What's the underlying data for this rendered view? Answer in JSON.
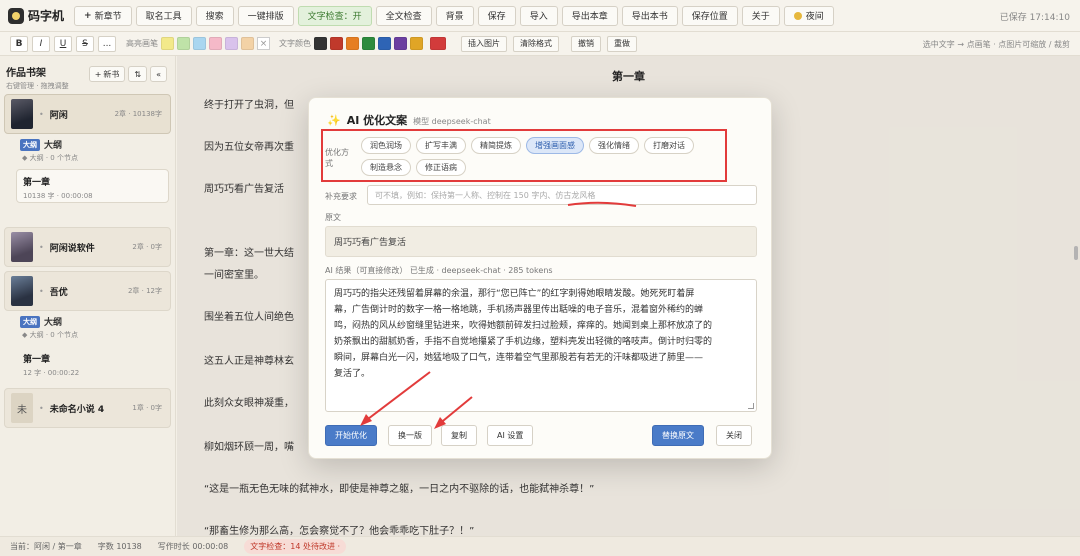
{
  "app": {
    "name": "码字机",
    "saved": "已保存 17:14:10"
  },
  "toolbar": [
    {
      "label": "新章节",
      "plus": true
    },
    {
      "label": "取名工具"
    },
    {
      "label": "搜索"
    },
    {
      "label": "一键排版"
    },
    {
      "label": "文字检查：开",
      "active": true
    },
    {
      "label": "全文检查"
    },
    {
      "label": "背景"
    },
    {
      "label": "保存"
    },
    {
      "label": "导入"
    },
    {
      "label": "导出本章"
    },
    {
      "label": "导出本书"
    },
    {
      "label": "保存位置"
    },
    {
      "label": "关于"
    },
    {
      "label": "夜间",
      "icon": "moon-icon"
    }
  ],
  "format": {
    "bold": "B",
    "italic": "I",
    "underline": "U",
    "strike": "S",
    "more": "...",
    "highlight_label": "高亮画笔",
    "highlight_colors": [
      "#f3e98a",
      "#bfe3a8",
      "#a9d6f0",
      "#f5b9c8",
      "#d9c2ec",
      "#f3d2a6"
    ],
    "clear_mark": "×",
    "text_color_label": "文字颜色",
    "text_colors": [
      "#333333",
      "#c0392b",
      "#e67e22",
      "#2e8b3d",
      "#2e64b5",
      "#6b3fa0",
      "#e0a526"
    ],
    "text_color_current": "#d23b3b",
    "insert_image": "插入图片",
    "clear_format": "清除格式",
    "undo": "撤销",
    "redo": "重做",
    "hint": "选中文字 → 点画笔 · 点图片可缩放 / 裁剪"
  },
  "sidebar": {
    "title": "作品书架",
    "subtitle": "右键管理 · 拖拽调整",
    "new_book": "新书",
    "sort": "⇅",
    "collapse": "«",
    "books": [
      {
        "name": "阿闲",
        "meta": "2章 · 10138字",
        "active": true
      },
      {
        "name": "阿闲说软件",
        "meta": "2章 · 0字"
      },
      {
        "name": "吾优",
        "meta": "2章 · 12字"
      },
      {
        "name": "未命名小说 4",
        "meta": "1章 · 0字",
        "cover_char": "未"
      }
    ],
    "outline_tag": "大纲",
    "outline1": {
      "title": "大纲",
      "sub": "◆ 大纲 · 0 个节点"
    },
    "chapter1": {
      "title": "第一章",
      "meta": "10138 字 · 00:00:08"
    },
    "outline2": {
      "title": "大纲",
      "sub": "◆ 大纲 · 0 个节点"
    },
    "chapter2": {
      "title": "第一章",
      "meta": "12 字 · 00:00:22"
    }
  },
  "editor": {
    "chapter_title": "第一章",
    "paragraphs": [
      "终于打开了虫洞，但",
      "因为五位女帝再次重",
      "周巧巧看广告复活",
      "第一章：这一世大结",
      "一间密室里。",
      "围坐着五位人间绝色",
      "这五人正是神尊林玄",
      "此刻众女眼神凝重，",
      "柳如烟环顾一周，嘴",
      "“这是一瓶无色无味的弑神水，即使是神尊之躯，一日之内不驱除的话，也能弑神杀尊！”",
      "“那畜生修为那么高，怎会察觉不了？他会乖乖吃下肚子？！”"
    ]
  },
  "status": {
    "location": "当前：阿闲 / 第一章",
    "words": "字数 10138",
    "time": "写作时长 00:00:08",
    "check": "文字检查：14 处待改进 ·"
  },
  "dialog": {
    "title": "AI 优化文案",
    "model": "模型 deepseek-chat",
    "opt_label": "优化方式",
    "options": [
      {
        "label": "润色润场"
      },
      {
        "label": "扩写丰满"
      },
      {
        "label": "精简提炼"
      },
      {
        "label": "增强画面感",
        "selected": true
      },
      {
        "label": "强化情绪"
      },
      {
        "label": "打磨对话"
      },
      {
        "label": "制造悬念"
      },
      {
        "label": "修正语病"
      }
    ],
    "supp_label": "补充要求",
    "supp_placeholder": "可不填，例如：保持第一人称、控制在 150 字内、仿古龙风格",
    "orig_label": "原文",
    "orig_text": "周巧巧看广告复活",
    "result_label": "AI 结果（可直接修改）   已生成 · deepseek-chat · 285 tokens",
    "result_lines": [
      "周巧巧的指尖还残留着屏幕的余温，那行“您已阵亡”的红字刺得她眼睛发酸。她死死盯着屏",
      "幕，广告倒计时的数字一格一格地跳，手机扬声器里传出聒噪的电子音乐，混着窗外稀约的蝉",
      "鸣，闷热的风从纱窗缝里钻进来，吹得她额前碎发扫过脸颊，痒痒的。她闻到桌上那杯放凉了的",
      "奶茶飘出的甜腻奶香，手指不自觉地攥紧了手机边缘，塑料壳发出轻微的咯吱声。倒计时归零的",
      "瞬间，屏幕白光一闪，她猛地吸了口气，连带着空气里那股若有若无的汗味都吸进了肺里——",
      "复活了。"
    ],
    "buttons": {
      "start": "开始优化",
      "retry": "换一版",
      "copy": "复制",
      "settings": "AI 设置",
      "replace": "替换原文",
      "close": "关闭"
    }
  },
  "colors": {
    "accent": "#4a7bc8",
    "annotation": "#e23b3b"
  }
}
